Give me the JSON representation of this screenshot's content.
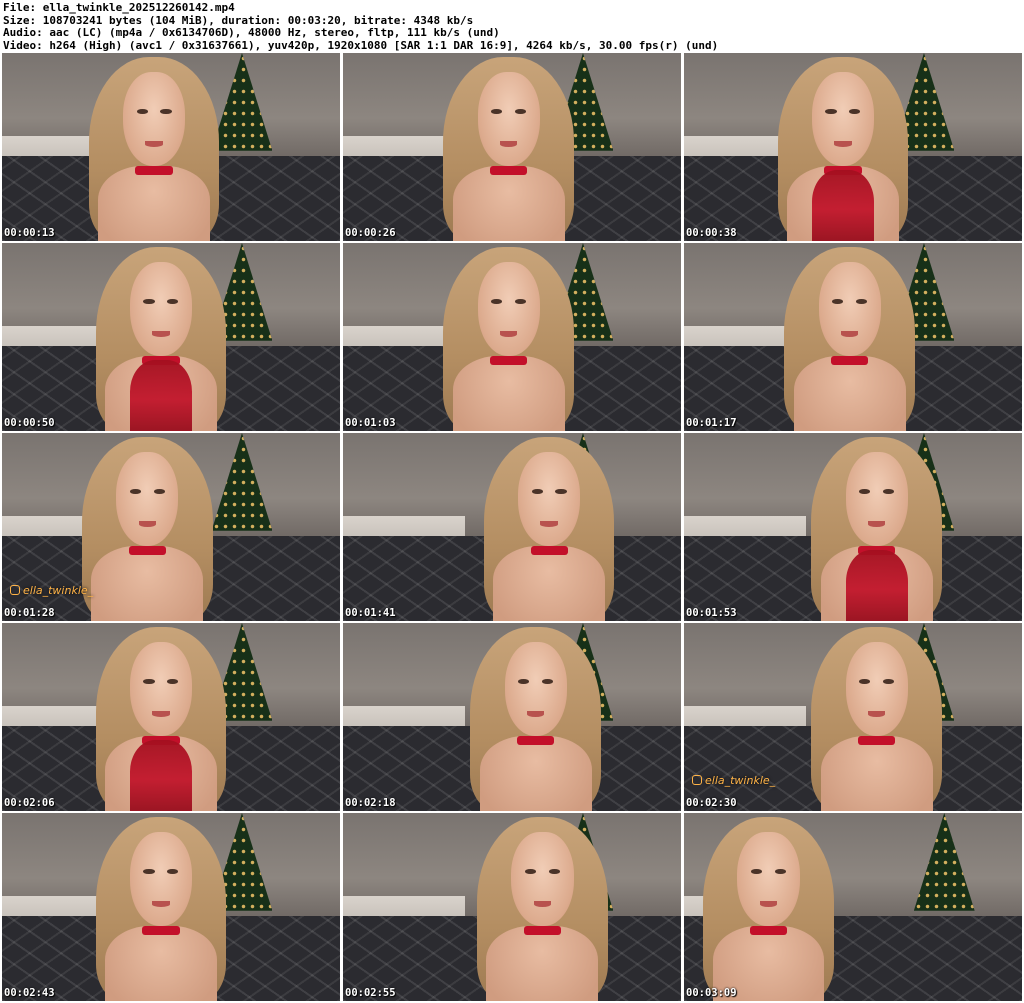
{
  "header": {
    "file": "File: ella_twinkle_202512260142.mp4",
    "size": "Size: 108703241 bytes (104 MiB), duration: 00:03:20, bitrate: 4348 kb/s",
    "audio": "Audio: aac (LC) (mp4a / 0x6134706D), 48000 Hz, stereo, fltp, 111 kb/s (und)",
    "video": "Video: h264 (High) (avc1 / 0x31637661), yuv420p, 1920x1080 [SAR 1:1 DAR 16:9], 4264 kb/s, 30.00 fps(r) (und)"
  },
  "thumbnails": [
    {
      "timestamp": "00:00:13",
      "handle": "",
      "glove": false
    },
    {
      "timestamp": "00:00:26",
      "handle": "",
      "glove": false
    },
    {
      "timestamp": "00:00:38",
      "handle": "",
      "glove": true
    },
    {
      "timestamp": "00:00:50",
      "handle": "",
      "glove": true
    },
    {
      "timestamp": "00:01:03",
      "handle": "",
      "glove": false
    },
    {
      "timestamp": "00:01:17",
      "handle": "",
      "glove": false
    },
    {
      "timestamp": "00:01:28",
      "handle": "ella_twinkle_",
      "glove": false
    },
    {
      "timestamp": "00:01:41",
      "handle": "",
      "glove": false
    },
    {
      "timestamp": "00:01:53",
      "handle": "",
      "glove": true
    },
    {
      "timestamp": "00:02:06",
      "handle": "",
      "glove": true
    },
    {
      "timestamp": "00:02:18",
      "handle": "",
      "glove": false
    },
    {
      "timestamp": "00:02:30",
      "handle": "ella_twinkle_",
      "glove": false
    },
    {
      "timestamp": "00:02:43",
      "handle": "",
      "glove": false
    },
    {
      "timestamp": "00:02:55",
      "handle": "",
      "glove": false
    },
    {
      "timestamp": "00:03:09",
      "handle": "",
      "glove": false
    }
  ]
}
